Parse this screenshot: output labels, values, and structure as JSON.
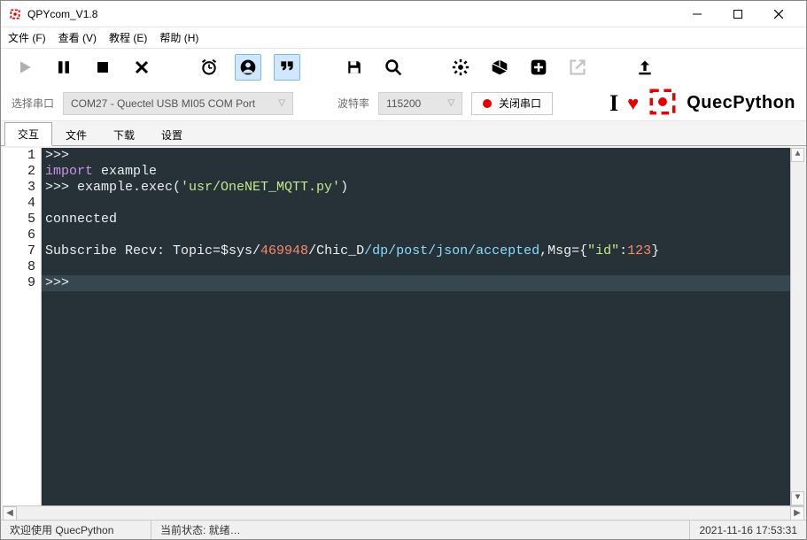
{
  "title": "QPYcom_V1.8",
  "menu": {
    "file": "文件 (F)",
    "view": "查看 (V)",
    "tutorial": "教程 (E)",
    "help": "帮助 (H)"
  },
  "toolbar": {
    "play": "play-icon",
    "pause": "pause-icon",
    "stop": "stop-icon",
    "cancel": "cancel-icon",
    "alarm": "alarm-icon",
    "user": "user-icon",
    "quote": "quote-icon",
    "save": "save-icon",
    "search": "search-icon",
    "settings": "gear-icon",
    "cube": "cube-icon",
    "add": "plus-icon",
    "share": "share-icon",
    "upload": "upload-icon"
  },
  "serial": {
    "port_label": "选择串口",
    "port_value": "COM27 - Quectel USB MI05 COM Port",
    "baud_label": "波特率",
    "baud_value": "115200",
    "close_label": "关闭串口"
  },
  "brand": {
    "i": "I",
    "text": "QuecPython"
  },
  "tabs": [
    "交互",
    "文件",
    "下载",
    "设置"
  ],
  "active_tab": 0,
  "code_lines": [
    {
      "n": 1,
      "segs": [
        {
          "t": ">>>",
          "c": "tok-white"
        }
      ]
    },
    {
      "n": 2,
      "segs": [
        {
          "t": "import",
          "c": "tok-key"
        },
        {
          "t": " example",
          "c": "tok-white"
        }
      ]
    },
    {
      "n": 3,
      "segs": [
        {
          "t": ">>> example.exec(",
          "c": "tok-white"
        },
        {
          "t": "'usr/OneNET_MQTT.py'",
          "c": "tok-str"
        },
        {
          "t": ")",
          "c": "tok-white"
        }
      ]
    },
    {
      "n": 4,
      "segs": []
    },
    {
      "n": 5,
      "segs": [
        {
          "t": "connected",
          "c": "tok-white"
        }
      ]
    },
    {
      "n": 6,
      "segs": []
    },
    {
      "n": 7,
      "segs": [
        {
          "t": "Subscribe Recv: Topic=$sys/",
          "c": "tok-white"
        },
        {
          "t": "469948",
          "c": "tok-num"
        },
        {
          "t": "/Chic_D",
          "c": "tok-white"
        },
        {
          "t": "/dp/post/json/accepted",
          "c": "tok-path"
        },
        {
          "t": ",Msg={",
          "c": "tok-white"
        },
        {
          "t": "\"id\"",
          "c": "tok-jsonkey"
        },
        {
          "t": ":",
          "c": "tok-white"
        },
        {
          "t": "123",
          "c": "tok-num"
        },
        {
          "t": "}",
          "c": "tok-white"
        }
      ]
    },
    {
      "n": 8,
      "segs": []
    },
    {
      "n": 9,
      "current": true,
      "segs": [
        {
          "t": ">>> ",
          "c": "tok-white"
        }
      ]
    }
  ],
  "status": {
    "welcome": "欢迎使用 QuecPython",
    "state": "当前状态: 就绪…",
    "timestamp": "2021-11-16 17:53:31"
  }
}
